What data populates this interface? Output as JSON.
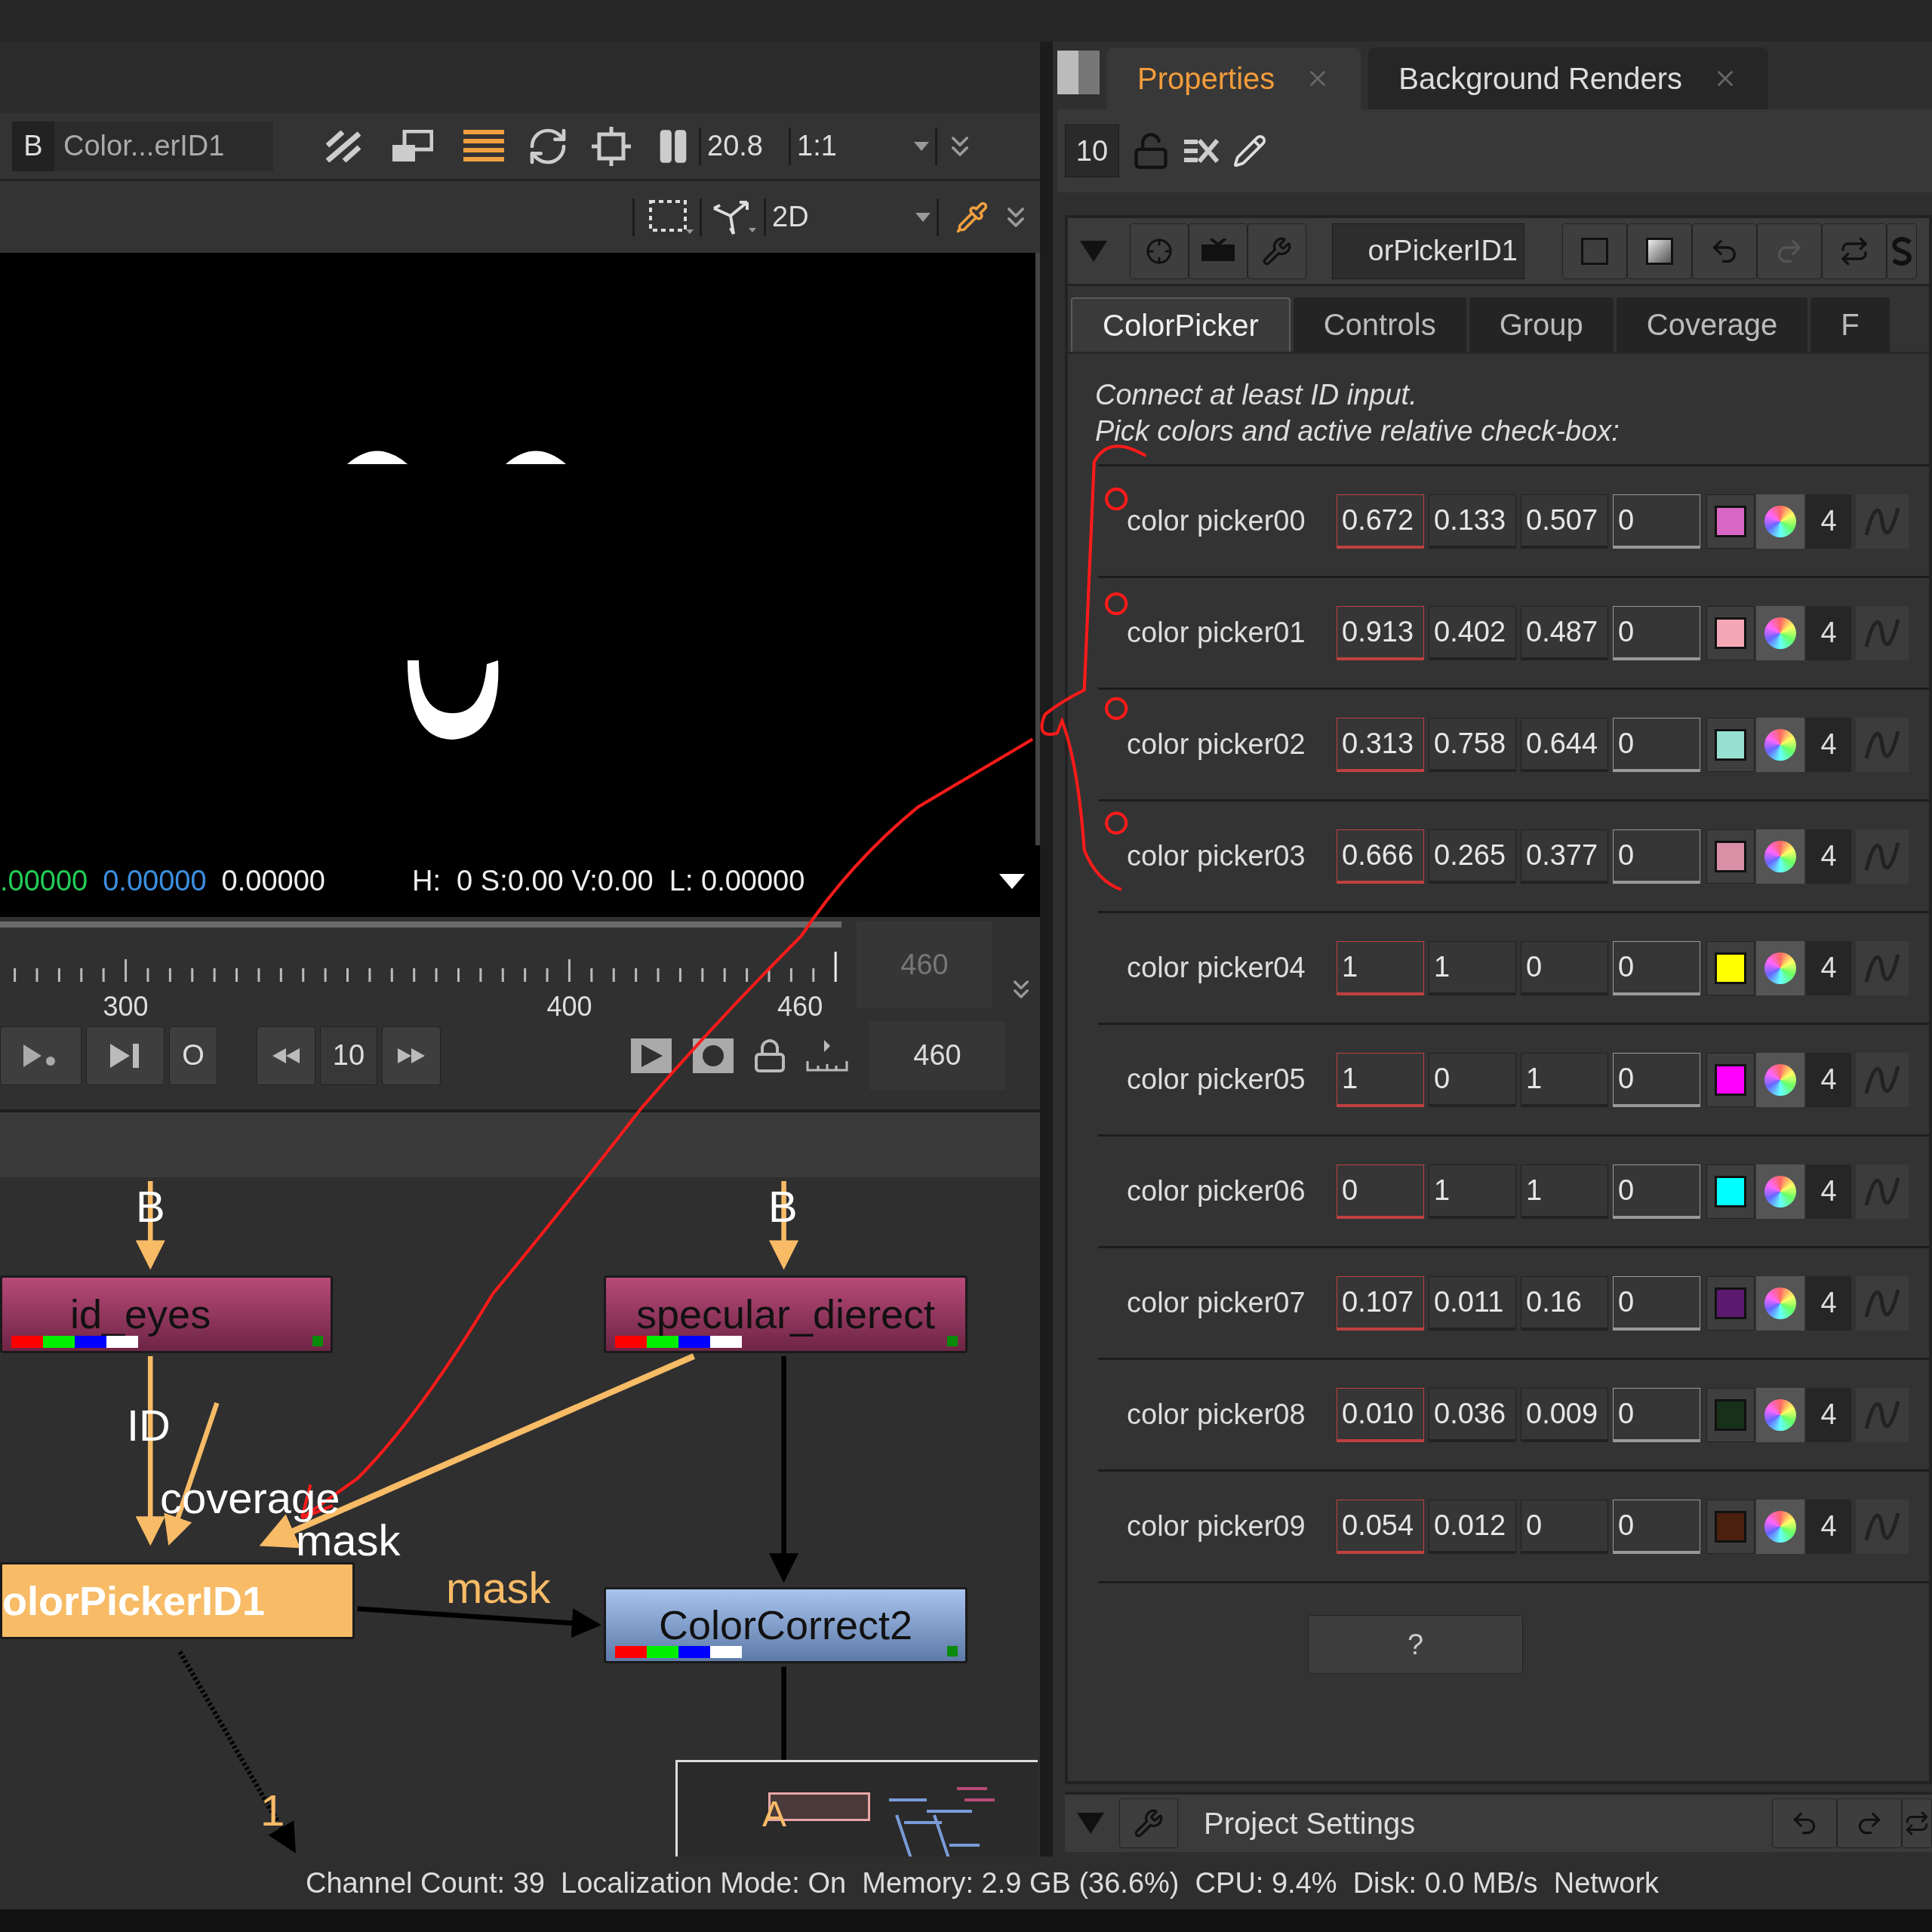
{
  "viewer": {
    "input": "B",
    "node_name": "Color...erID1",
    "zoom": "20.8",
    "ratio": "1:1",
    "view_mode": "2D",
    "readout": {
      "green": ".00000",
      "blue": "0.00000",
      "alpha": "0.00000",
      "hsvl": "H:  0 S:0.00 V:0.00  L: 0.00000"
    },
    "timeline": {
      "labels": [
        "300",
        "400",
        "460"
      ],
      "current_frame": "460",
      "step": "10",
      "mode_button": "O",
      "end_frame": "460"
    }
  },
  "node_graph": {
    "nodes": [
      {
        "label": "id_eyes",
        "kind": "read"
      },
      {
        "label": "specular_dierect",
        "kind": "read"
      },
      {
        "label": "olorPickerID1",
        "kind": "selected"
      },
      {
        "label": "ColorCorrect2",
        "kind": "color"
      }
    ],
    "edge_labels": [
      {
        "text": "B",
        "kind": "input"
      },
      {
        "text": "B",
        "kind": "input"
      },
      {
        "text": "ID",
        "kind": "input"
      },
      {
        "text": "coverage",
        "kind": "input"
      },
      {
        "text": "mask",
        "kind": "input"
      },
      {
        "text": "mask",
        "kind": "mask"
      },
      {
        "text": "1",
        "kind": "mask"
      }
    ],
    "minimap_label": "A"
  },
  "properties": {
    "tabs": [
      {
        "label": "Properties",
        "selected": true
      },
      {
        "label": "Background Renders",
        "selected": false
      }
    ],
    "max_panels": "10",
    "node_name": "orPickerID1",
    "subtabs": [
      {
        "label": "ColorPicker",
        "selected": true
      },
      {
        "label": "Controls",
        "selected": false
      },
      {
        "label": "Group",
        "selected": false
      },
      {
        "label": "Coverage",
        "selected": false
      },
      {
        "label": "F",
        "selected": false
      }
    ],
    "help": [
      "Connect at least ID input.",
      "Pick colors and active relative check-box:"
    ],
    "pickers": [
      {
        "label": "color picker00",
        "values": [
          "0.672",
          "0.133",
          "0.507",
          "0"
        ],
        "color": "#d866c4",
        "channels": "4"
      },
      {
        "label": "color picker01",
        "values": [
          "0.913",
          "0.402",
          "0.487",
          "0"
        ],
        "color": "#f4a8b6",
        "channels": "4"
      },
      {
        "label": "color picker02",
        "values": [
          "0.313",
          "0.758",
          "0.644",
          "0"
        ],
        "color": "#97e0d1",
        "channels": "4"
      },
      {
        "label": "color picker03",
        "values": [
          "0.666",
          "0.265",
          "0.377",
          "0"
        ],
        "color": "#d990a6",
        "channels": "4"
      },
      {
        "label": "color picker04",
        "values": [
          "1",
          "1",
          "0",
          "0"
        ],
        "color": "#ffff00",
        "channels": "4"
      },
      {
        "label": "color picker05",
        "values": [
          "1",
          "0",
          "1",
          "0"
        ],
        "color": "#ff00ff",
        "channels": "4"
      },
      {
        "label": "color picker06",
        "values": [
          "0",
          "1",
          "1",
          "0"
        ],
        "color": "#00ffff",
        "channels": "4"
      },
      {
        "label": "color picker07",
        "values": [
          "0.107",
          "0.011",
          "0.16",
          "0"
        ],
        "color": "#5b1a70",
        "channels": "4"
      },
      {
        "label": "color picker08",
        "values": [
          "0.010",
          "0.036",
          "0.009",
          "0"
        ],
        "color": "#17301a",
        "channels": "4"
      },
      {
        "label": "color picker09",
        "values": [
          "0.054",
          "0.012",
          "0",
          "0"
        ],
        "color": "#4b200f",
        "channels": "4"
      }
    ],
    "help_button": "?",
    "project_settings": "Project Settings"
  },
  "status_bar": "Channel Count: 39  Localization Mode: On  Memory: 2.9 GB (36.6%)  CPU: 9.4%  Disk: 0.0 MB/s  Network"
}
